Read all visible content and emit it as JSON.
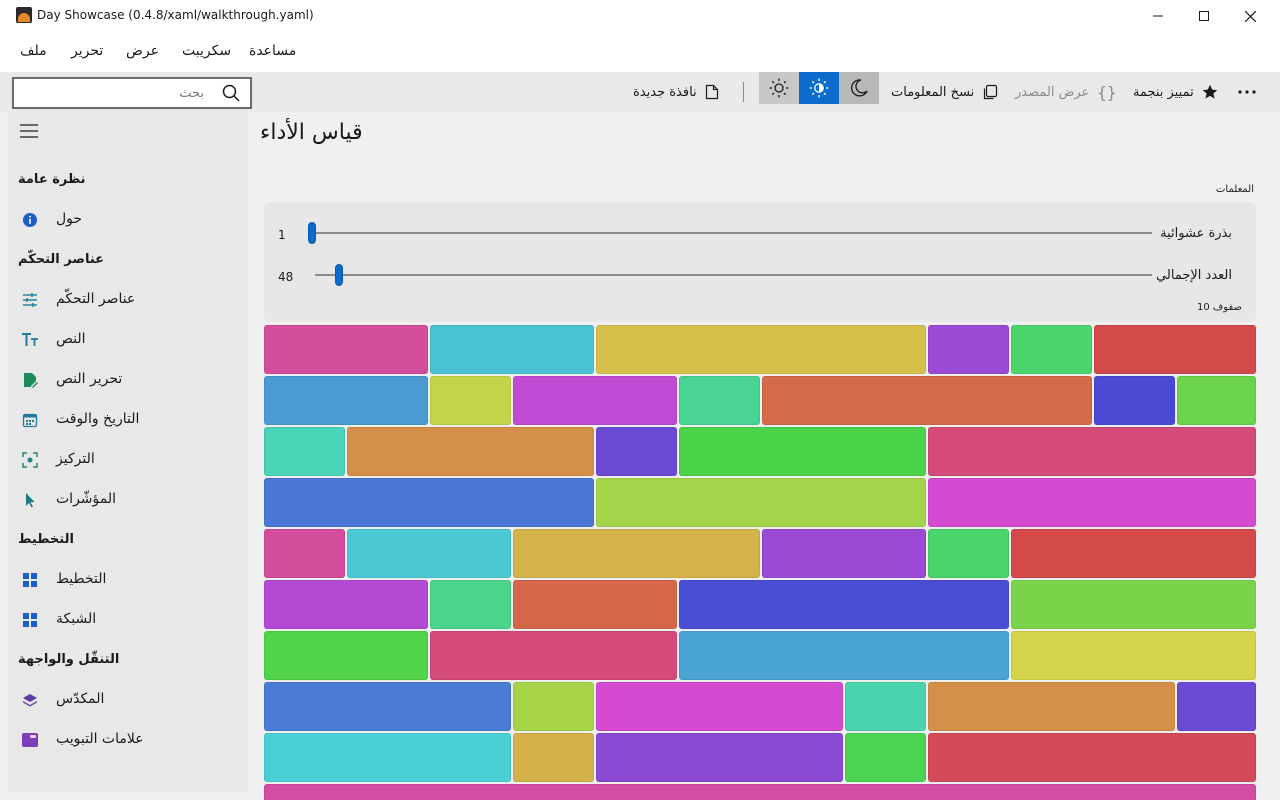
{
  "window": {
    "title": "Day Showcase (0.4.8/xaml/walkthrough.yaml)"
  },
  "menu": {
    "items": [
      "ملف",
      "تحرير",
      "عرض",
      "سكريبت",
      "مساعدة"
    ]
  },
  "toolbar": {
    "search_placeholder": "بحث",
    "new_window": "نافذة جديدة",
    "copy_info": "نسخ المعلومات",
    "view_source": "عرض المصدر",
    "star": "تمييز بنجمة",
    "more": "..."
  },
  "sidebar": {
    "sections": [
      {
        "title": "نظرة عامة",
        "items": [
          {
            "label": "حول",
            "icon": "info-icon"
          }
        ]
      },
      {
        "title": "عناصر التحكّم",
        "items": [
          {
            "label": "عناصر التحكّم",
            "icon": "sliders-icon"
          },
          {
            "label": "النص",
            "icon": "text-icon"
          },
          {
            "label": "تحرير النص",
            "icon": "edit-document-icon"
          },
          {
            "label": "التاريخ والوقت",
            "icon": "calendar-icon"
          },
          {
            "label": "التركيز",
            "icon": "focus-icon"
          },
          {
            "label": "المؤشّرات",
            "icon": "pointer-icon"
          }
        ]
      },
      {
        "title": "التخطيط",
        "items": [
          {
            "label": "التخطيط",
            "icon": "layout-icon"
          },
          {
            "label": "الشبكة",
            "icon": "grid-icon"
          }
        ]
      },
      {
        "title": "التنقّل والواجهة",
        "items": [
          {
            "label": "المكدّس",
            "icon": "stack-icon"
          },
          {
            "label": "علامات التبويب",
            "icon": "tabs-icon"
          }
        ]
      }
    ]
  },
  "main": {
    "title": "قياس الأداء",
    "params_label": "المعلمات",
    "seed": {
      "label": "بذرة عشوائية",
      "value": "1",
      "fraction": 0.0
    },
    "total": {
      "label": "العدد الإجمالي",
      "value": "48",
      "fraction": 0.03
    },
    "rows_label": "10 صفوف"
  },
  "colors": {
    "accent": "#0b6bcc",
    "sidebar_icon": "#1e7a9e"
  }
}
